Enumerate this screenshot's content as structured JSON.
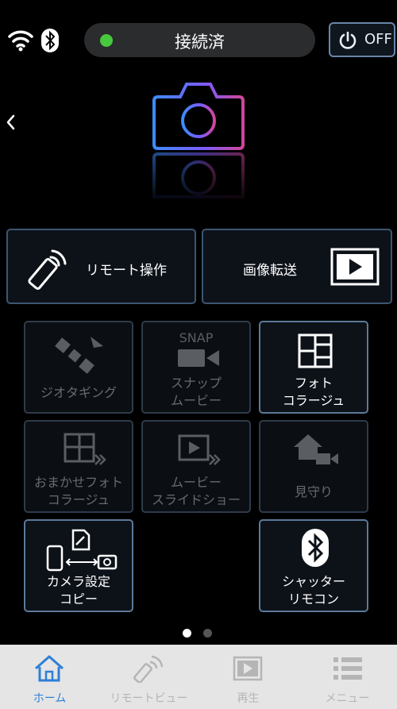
{
  "status": {
    "connection_label": "接続済",
    "power_label": "OFF"
  },
  "buttons": {
    "remote": "リモート操作",
    "transfer": "画像転送"
  },
  "tiles": [
    {
      "line1": "ジオタギング",
      "line2": ""
    },
    {
      "line1": "スナップ",
      "line2": "ムービー",
      "icon_text": "SNAP"
    },
    {
      "line1": "フォト",
      "line2": "コラージュ"
    },
    {
      "line1": "おまかせフォト",
      "line2": "コラージュ"
    },
    {
      "line1": "ムービー",
      "line2": "スライドショー"
    },
    {
      "line1": "見守り",
      "line2": ""
    },
    {
      "line1": "カメラ設定",
      "line2": "コピー"
    },
    {
      "line1": "シャッター",
      "line2": "リモコン"
    }
  ],
  "pager": {
    "current": 1,
    "total": 2
  },
  "tabs": [
    {
      "label": "ホーム",
      "active": true
    },
    {
      "label": "リモートビュー",
      "active": false
    },
    {
      "label": "再生",
      "active": false
    },
    {
      "label": "メニュー",
      "active": false
    }
  ],
  "colors": {
    "accent": "#2e7fd6",
    "connected": "#47c93e",
    "disabled": "#676b70",
    "tab_inactive": "#b5b5b5"
  }
}
